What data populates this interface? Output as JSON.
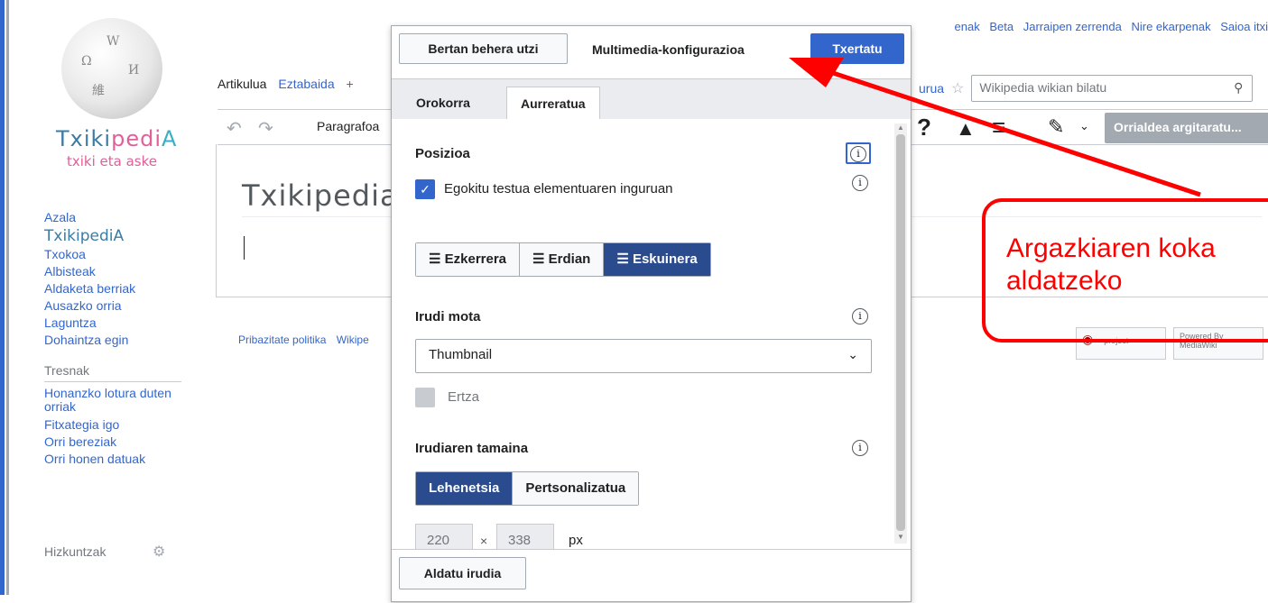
{
  "sidebar": {
    "logo_wordmark": [
      "Txiki",
      "pedi",
      "A"
    ],
    "logo_tagline": "txiki eta aske",
    "nav": [
      "Azala",
      "TxikipediA",
      "Txokoa",
      "Albisteak",
      "Aldaketa berriak",
      "Ausazko orria",
      "Laguntza",
      "Dohaintza egin"
    ],
    "tools_heading": "Tresnak",
    "tools": [
      "Honanzko lotura duten orriak",
      "Fitxategia igo",
      "Orri bereziak",
      "Orri honen datuak"
    ],
    "languages_heading": "Hizkuntzak"
  },
  "personal": [
    "Beta",
    "Jarraipen zerrenda",
    "Nire ekarpenak",
    "Saioa itxi"
  ],
  "personal_partial": "enak",
  "tabs": {
    "article": "Artikulua",
    "talk": "Eztabaida",
    "history_partial": "urua"
  },
  "search": {
    "placeholder": "Wikipedia wikian bilatu"
  },
  "toolbar": {
    "paragraph": "Paragrafoa",
    "publish": "Orrialdea argitaratu..."
  },
  "page": {
    "title": "Txikipedia:"
  },
  "footer": {
    "privacy": "Pribazitate politika",
    "about_partial": "Wikipe"
  },
  "badges": [
    "project",
    "Powered By MediaWiki"
  ],
  "dialog": {
    "cancel": "Bertan behera utzi",
    "title": "Multimedia-konfigurazioa",
    "insert": "Txertatu",
    "tabs": [
      "Orokorra",
      "Aurreratua"
    ],
    "position": {
      "heading": "Posizioa",
      "wrap_label": "Egokitu testua elementuaren inguruan",
      "wrap_checked": true,
      "alignments": [
        "Ezkerrera",
        "Erdian",
        "Eskuinera"
      ],
      "selected": "Eskuinera"
    },
    "image_type": {
      "heading": "Irudi mota",
      "value": "Thumbnail",
      "border_label": "Ertza"
    },
    "image_size": {
      "heading": "Irudiaren tamaina",
      "options": [
        "Lehenetsia",
        "Pertsonalizatua"
      ],
      "selected": "Lehenetsia",
      "width": "220",
      "height": "338",
      "times": "×",
      "unit": "px"
    },
    "change_image": "Aldatu irudia"
  },
  "annotation": {
    "text_line1": "Argazkiaren koka",
    "text_line2": "aldatzeko",
    "color": "#ff0000"
  }
}
